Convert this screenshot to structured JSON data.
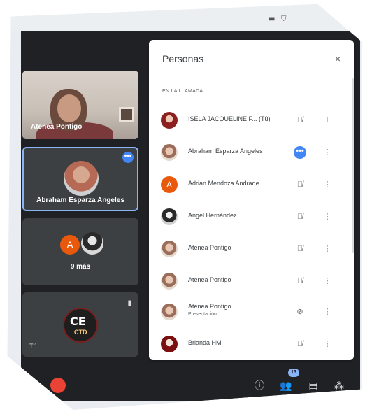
{
  "chrome": {
    "icon_a": "▬",
    "icon_b": "⛉"
  },
  "tiles": {
    "tile1_name": "Atenea Pontigo",
    "tile2_name": "Abraham Esparza Angeles",
    "tile2_menu": "•••",
    "tile3_avatar_letter": "A",
    "tile3_more": "9 más",
    "tile4_logo_top": "CE",
    "tile4_logo_bottom": "CTD",
    "tile4_you": "Tú"
  },
  "panel": {
    "title": "Personas",
    "close": "×",
    "section": "EN LA LLAMADA",
    "participants": [
      {
        "name": "ISELA JACQUELINE F... (Tú)",
        "icon1": "mic-off-icon",
        "icon1_glyph": "🎙̸",
        "icon2": "pin-icon",
        "icon2_glyph": "⊥"
      },
      {
        "name": "Abraham Esparza Angeles",
        "icon1": "more-dots-icon",
        "icon1_glyph": "•••",
        "icon2": "kebab-menu-icon",
        "icon2_glyph": "⋮"
      },
      {
        "name": "Adrian Mendoza Andrade",
        "avatar_letter": "A",
        "icon1": "mic-off-icon",
        "icon1_glyph": "🎙̸",
        "icon2": "kebab-menu-icon",
        "icon2_glyph": "⋮"
      },
      {
        "name": "Angel Hernández",
        "icon1": "mic-off-icon",
        "icon1_glyph": "🎙̸",
        "icon2": "kebab-menu-icon",
        "icon2_glyph": "⋮"
      },
      {
        "name": "Atenea Pontigo",
        "icon1": "mic-off-icon",
        "icon1_glyph": "🎙̸",
        "icon2": "kebab-menu-icon",
        "icon2_glyph": "⋮"
      },
      {
        "name": "Atenea Pontigo",
        "icon1": "mic-off-icon",
        "icon1_glyph": "🎙̸",
        "icon2": "kebab-menu-icon",
        "icon2_glyph": "⋮"
      },
      {
        "name": "Atenea Pontigo",
        "subtitle": "Presentación",
        "icon1": "presenting-off-icon",
        "icon1_glyph": "⊘",
        "icon2": "kebab-menu-icon",
        "icon2_glyph": "⋮"
      },
      {
        "name": "Brianda HM",
        "icon1": "mic-off-icon",
        "icon1_glyph": "🎙̸",
        "icon2": "kebab-menu-icon",
        "icon2_glyph": "⋮"
      }
    ]
  },
  "bottom": {
    "info_glyph": "ⓘ",
    "people_glyph": "👥",
    "people_count": "13",
    "chat_glyph": "▤",
    "activities_glyph": "⁂"
  },
  "colors": {
    "accent": "#8ab4f8",
    "meet_bg": "#202124",
    "tile_bg": "#3c4043",
    "end_call": "#ea4335"
  }
}
